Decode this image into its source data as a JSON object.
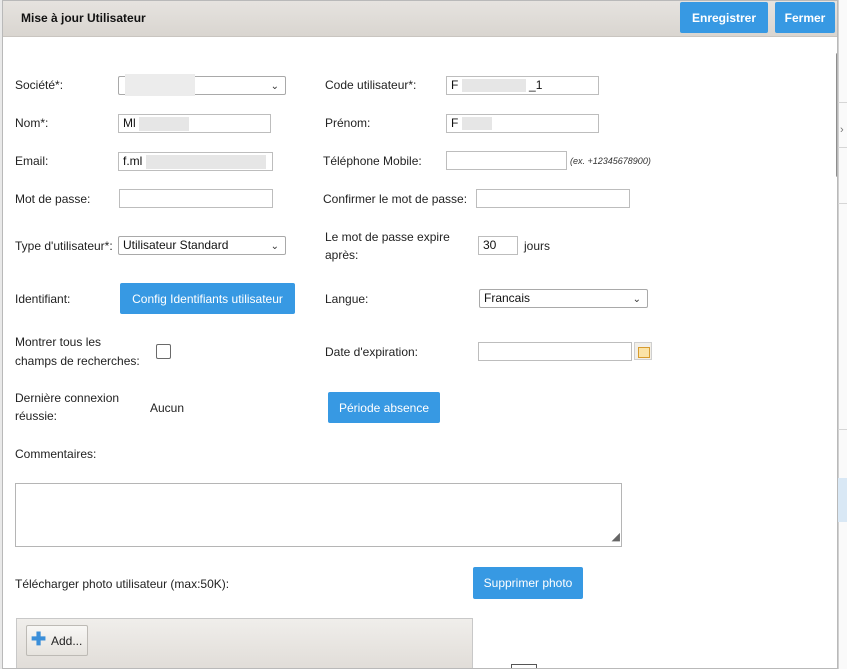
{
  "dialog": {
    "title": "Mise à jour Utilisateur",
    "save_label": "Enregistrer",
    "close_label": "Fermer"
  },
  "form": {
    "company_label": "Société*:",
    "user_code_label": "Code utilisateur*:",
    "user_code_value": "F",
    "user_code_suffix": "_1",
    "last_name_label": "Nom*:",
    "last_name_value": "Ml",
    "first_name_label": "Prénom:",
    "first_name_value": "F",
    "email_label": "Email:",
    "email_value": "f.ml",
    "mobile_label": "Téléphone Mobile:",
    "mobile_value": "",
    "mobile_hint": "(ex. +12345678900)",
    "password_label": "Mot de passe:",
    "confirm_password_label": "Confirmer le mot de passe:",
    "user_type_label": "Type d'utilisateur*:",
    "user_type_value": "Utilisateur Standard",
    "password_expires_label_1": "Le mot de passe expire",
    "password_expires_label_2": "après:",
    "password_expires_value": "30",
    "password_expires_unit": "jours",
    "identifier_label": "Identifiant:",
    "identifier_button": "Config Identifiants utilisateur",
    "language_label": "Langue:",
    "language_value": "Francais",
    "show_all_label_1": "Montrer tous les",
    "show_all_label_2": "champs de recherches:",
    "expiration_date_label": "Date d'expiration:",
    "last_login_label_1": "Dernière connexion",
    "last_login_label_2": "réussie:",
    "last_login_value": "Aucun",
    "absence_button": "Période absence",
    "comments_label": "Commentaires:",
    "photo_label": "Télécharger photo utilisateur (max:50K):",
    "delete_photo_button": "Supprimer photo",
    "add_button": "Add..."
  },
  "icons": {
    "dropdown": "chevron-down-icon",
    "calendar": "calendar-icon",
    "add": "plus-icon",
    "resize": "resize-grip-icon"
  },
  "colors": {
    "accent": "#3799e3",
    "titlebar": "#dcd8d3"
  }
}
